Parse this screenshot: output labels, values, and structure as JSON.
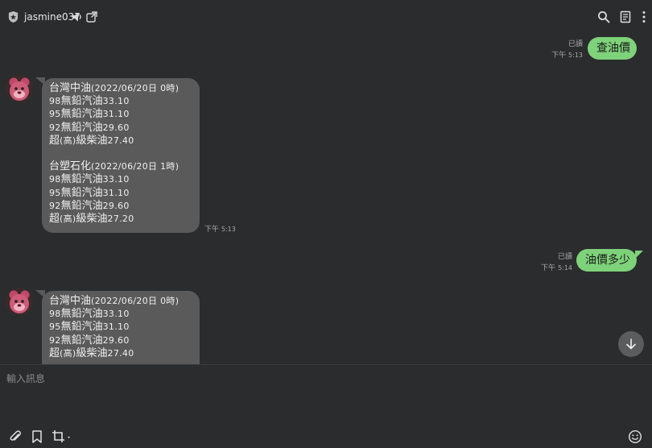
{
  "header": {
    "title": "jasmine037"
  },
  "messages": [
    {
      "type": "out",
      "read": "已讀",
      "time_label": "下午",
      "time": "5:13",
      "text": "查油價"
    },
    {
      "type": "in",
      "time_label": "下午",
      "time": "5:13",
      "lines": [
        {
          "a": "台灣中油",
          "b": "(2022/06/20日 0時)"
        },
        {
          "a": "98",
          "b": "無鉛汽油",
          "c": "33.10"
        },
        {
          "a": "95",
          "b": "無鉛汽油",
          "c": "31.10"
        },
        {
          "a": "92",
          "b": "無鉛汽油",
          "c": "29.60"
        },
        {
          "a": "超",
          "b": "(高)",
          "c": "級柴油",
          "d": "27.40"
        },
        {
          "blank": true
        },
        {
          "a": "台塑石化",
          "b": "(2022/06/20日 1時)"
        },
        {
          "a": "98",
          "b": "無鉛汽油",
          "c": "33.10"
        },
        {
          "a": "95",
          "b": "無鉛汽油",
          "c": "31.10"
        },
        {
          "a": "92",
          "b": "無鉛汽油",
          "c": "29.60"
        },
        {
          "a": "超",
          "b": "(高)",
          "c": "級柴油",
          "d": "27.20"
        }
      ]
    },
    {
      "type": "out",
      "read": "已讀",
      "time_label": "下午",
      "time": "5:14",
      "text": "油價多少"
    },
    {
      "type": "in",
      "lines": [
        {
          "a": "台灣中油",
          "b": "(2022/06/20日 0時)"
        },
        {
          "a": "98",
          "b": "無鉛汽油",
          "c": "33.10"
        },
        {
          "a": "95",
          "b": "無鉛汽油",
          "c": "31.10"
        },
        {
          "a": "92",
          "b": "無鉛汽油",
          "c": "29.60"
        },
        {
          "a": "超",
          "b": "(高)",
          "c": "級柴油",
          "d": "27.40"
        }
      ]
    }
  ],
  "composer": {
    "placeholder": "輸入訊息"
  },
  "icons": {
    "shield": "shield-icon",
    "speaker": "speaker-icon",
    "external": "external-window-icon",
    "search": "search-icon",
    "notes": "notes-icon",
    "more": "more-vertical-icon",
    "scroll": "arrow-down-icon",
    "attach": "paperclip-icon",
    "bookmark": "bookmark-icon",
    "crop": "crop-icon",
    "emoji": "emoji-icon"
  },
  "colors": {
    "background": "#2b2c2e",
    "outgoing_bubble": "#7ed27a",
    "incoming_bubble": "#5a5a5b"
  }
}
